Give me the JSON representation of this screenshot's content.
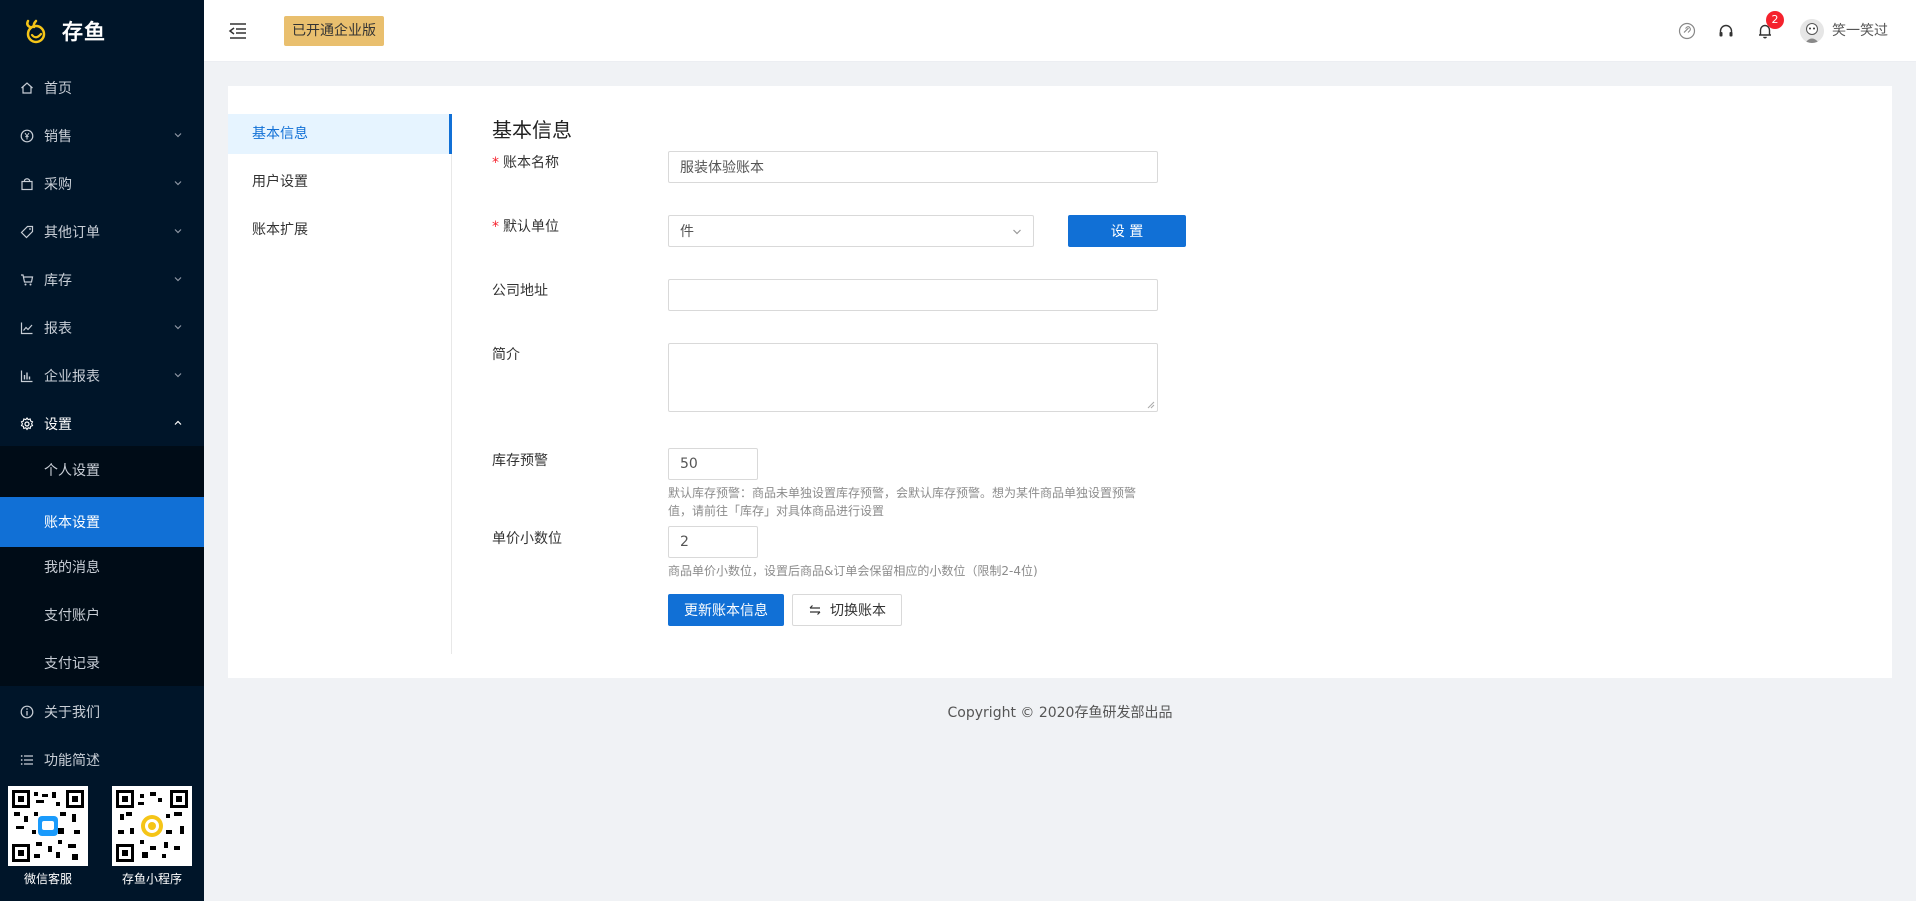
{
  "app": {
    "name": "存鱼",
    "brand_color": "#1170d6",
    "sidebar_color": "#001529",
    "enterprise_badge": "已开通企业版"
  },
  "sidebar": {
    "items": [
      {
        "label": "首页",
        "icon": "home-icon"
      },
      {
        "label": "销售",
        "icon": "yen-circle-icon"
      },
      {
        "label": "采购",
        "icon": "shopping-bag-icon"
      },
      {
        "label": "其他订单",
        "icon": "tag-icon"
      },
      {
        "label": "库存",
        "icon": "cart-icon"
      },
      {
        "label": "报表",
        "icon": "line-chart-icon"
      },
      {
        "label": "企业报表",
        "icon": "bar-chart-icon"
      },
      {
        "label": "设置",
        "icon": "gear-icon"
      }
    ],
    "settings_sub": [
      {
        "label": "个人设置"
      },
      {
        "label": "账本设置"
      },
      {
        "label": "我的消息"
      },
      {
        "label": "支付账户"
      },
      {
        "label": "支付记录"
      }
    ],
    "bottom_items": [
      {
        "label": "关于我们",
        "icon": "info-circle-icon"
      },
      {
        "label": "功能简述",
        "icon": "list-icon"
      }
    ],
    "qr_codes": [
      {
        "label": "微信客服"
      },
      {
        "label": "存鱼小程序"
      }
    ]
  },
  "header": {
    "notification_count": "2",
    "username": "笑一笑过"
  },
  "tabs": [
    {
      "label": "基本信息"
    },
    {
      "label": "用户设置"
    },
    {
      "label": "账本扩展"
    }
  ],
  "form": {
    "title": "基本信息",
    "book_name_label": "账本名称",
    "book_name_value": "服装体验账本",
    "unit_label": "默认单位",
    "unit_value": "件",
    "unit_set_button": "设 置",
    "address_label": "公司地址",
    "address_value": "",
    "intro_label": "简介",
    "intro_value": "",
    "stock_warn_label": "库存预警",
    "stock_warn_value": "50",
    "stock_warn_hint": "默认库存预警：商品未单独设置库存预警，会默认库存预警。想为某件商品单独设置预警值，请前往「库存」对具体商品进行设置",
    "price_decimal_label": "单价小数位",
    "price_decimal_value": "2",
    "price_decimal_hint": "商品单价小数位，设置后商品&订单会保留相应的小数位（限制2-4位)",
    "update_button": "更新账本信息",
    "switch_button": "切换账本"
  },
  "footer": {
    "copyright": "Copyright © 2020存鱼研发部出品"
  }
}
